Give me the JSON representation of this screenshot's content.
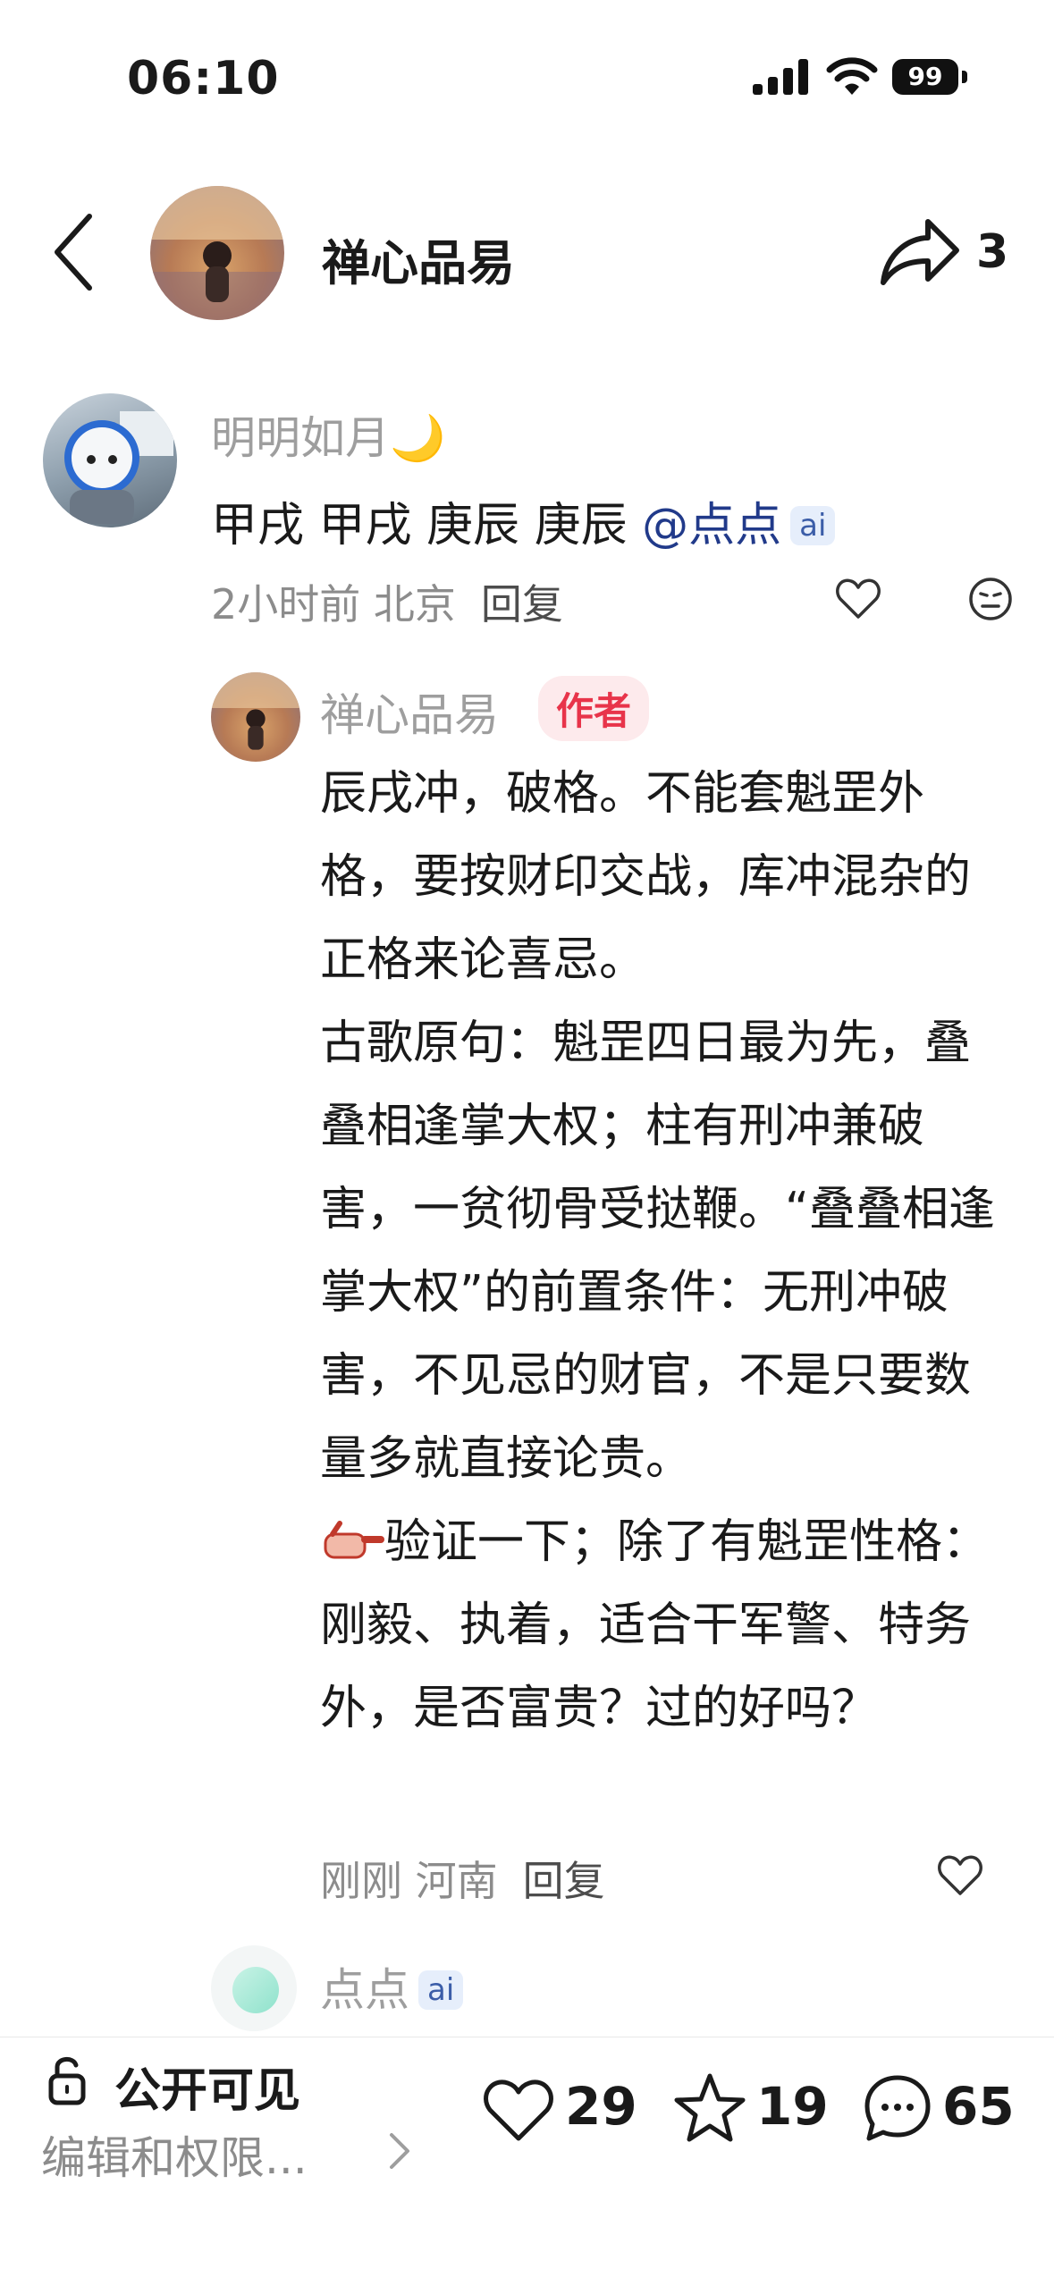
{
  "status_bar": {
    "time": "06:10",
    "battery": "99"
  },
  "header": {
    "title": "禅心品易",
    "share_count": "3"
  },
  "comment": {
    "user": "明明如月🌙",
    "text_main": "甲戌 甲戌 庚辰 庚辰 ",
    "mention": "@点点",
    "ai_badge": "ai",
    "meta": "2小时前 北京",
    "reply_label": "回复"
  },
  "reply": {
    "user": "禅心品易",
    "author_tag": "作者",
    "paragraphs": [
      "辰戌冲，破格。不能套魁罡外格，要按财印交战，库冲混杂的正格来论喜忌。",
      "古歌原句：魁罡四日最为先，叠叠相逢掌大权；柱有刑冲兼破害，一贫彻骨受挞鞭。“叠叠相逢掌大权”的前置条件：无刑冲破害，不见忌的财官，不是只要数量多就直接论贵。"
    ],
    "paragraph_last": "验证一下；除了有魁罡性格：刚毅、执着，适合干军警、特务外，是否富贵？过的好吗？",
    "meta": "刚刚 河南",
    "reply_label": "回复"
  },
  "ai_reply": {
    "user": "点点",
    "ai_badge": "ai"
  },
  "bottom_bar": {
    "visibility": "公开可见",
    "edit": "编辑和权限...",
    "likes": "29",
    "favorites": "19",
    "comments": "65"
  }
}
